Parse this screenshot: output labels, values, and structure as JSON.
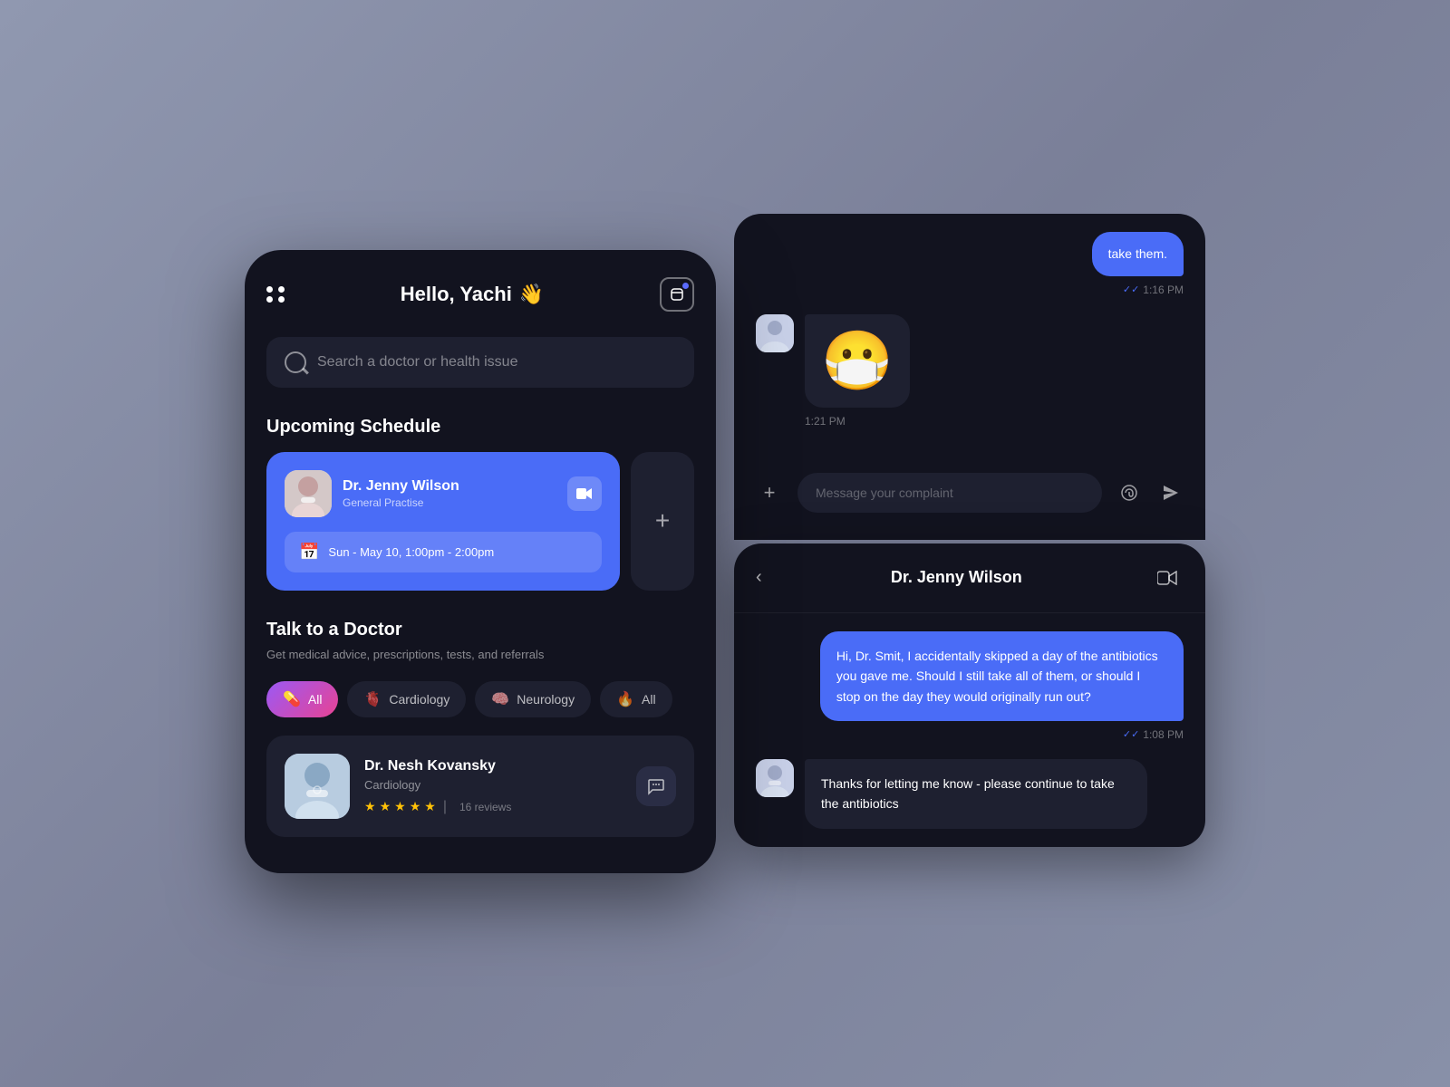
{
  "app": {
    "background_color": "#8b8fa8"
  },
  "left_phone": {
    "header": {
      "greeting": "Hello, Yachi",
      "greeting_emoji": "👋",
      "dots_label": "menu-dots"
    },
    "search": {
      "placeholder": "Search a doctor or health issue"
    },
    "upcoming_schedule": {
      "title": "Upcoming Schedule",
      "doctor_name": "Dr. Jenny Wilson",
      "doctor_specialty": "General Practise",
      "appointment_time": "Sun - May 10, 1:00pm - 2:00pm",
      "add_button_label": "+"
    },
    "talk_section": {
      "title": "Talk to a Doctor",
      "subtitle": "Get medical advice, prescriptions, tests, and referrals",
      "filters": [
        {
          "label": "All",
          "emoji": "💊",
          "active": true
        },
        {
          "label": "Cardiology",
          "emoji": "🫀",
          "active": false
        },
        {
          "label": "Neurology",
          "emoji": "🧠",
          "active": false
        },
        {
          "label": "All",
          "emoji": "🔥",
          "active": false
        }
      ],
      "doctor": {
        "name": "Dr. Nesh Kovansky",
        "specialty": "Cardiology",
        "stars": 4.5,
        "star_count": 5,
        "reviews": "16 reviews"
      }
    }
  },
  "right_top_chat": {
    "messages": [
      {
        "type": "sent",
        "text": "take them.",
        "time": "1:16 PM",
        "read": true
      },
      {
        "type": "received",
        "emoji": "😷",
        "time": "1:21 PM"
      }
    ],
    "input": {
      "placeholder": "Message your complaint"
    }
  },
  "right_bottom_chat": {
    "header": {
      "doctor_name": "Dr. Jenny Wilson"
    },
    "messages": [
      {
        "type": "sent",
        "text": "Hi, Dr. Smit, I accidentally skipped a day of the antibiotics you gave me. Should I still take all of them, or should I stop on the day they would originally run out?",
        "time": "1:08 PM",
        "read": true
      },
      {
        "type": "received",
        "text": "Thanks for letting me know - please continue to take the antibiotics"
      }
    ]
  }
}
